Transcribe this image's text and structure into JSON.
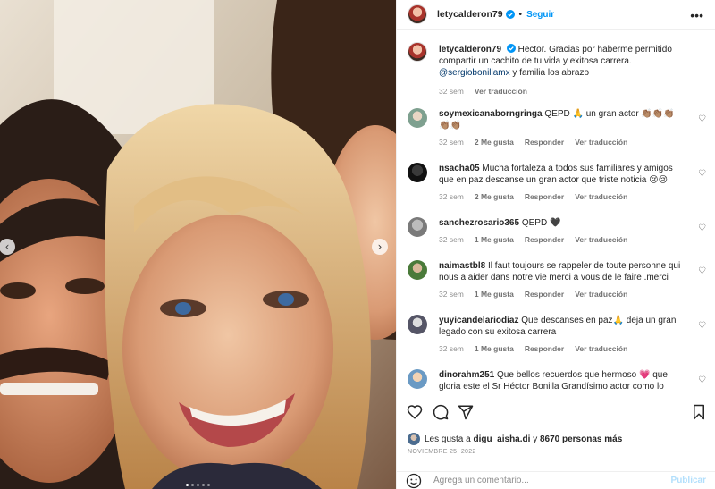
{
  "colors": {
    "accent": "#0095f6",
    "muted": "#8e8e8e",
    "mention": "#00376b",
    "post_disabled": "#b2dffc"
  },
  "photo": {
    "slides": 5,
    "active_slide": 1
  },
  "header": {
    "username": "letycalderon79",
    "separator": "•",
    "follow_label": "Seguir",
    "more_icon": "more-horizontal-icon"
  },
  "caption": {
    "username": "letycalderon79",
    "text_before_mention": "Hector. Gracias por haberme permitido compartir un cachito de tu vida y exitosa carrera.",
    "mention": "@sergiobonillamx",
    "text_after_mention": " y familia los abrazo",
    "time": "32 sem",
    "translate": "Ver traducción"
  },
  "comments": [
    {
      "username": "soymexicanaborngringa",
      "text": "QEPD 🙏 un gran actor 👏🏽👏🏽👏🏽👏🏽👏🏽",
      "time": "32 sem",
      "likes": "2 Me gusta",
      "reply": "Responder",
      "translate": "Ver traducción"
    },
    {
      "username": "nsacha05",
      "text": "Mucha fortaleza a todos sus familiares y amigos que en paz descanse un gran actor que triste noticia 😢😢",
      "time": "32 sem",
      "likes": "2 Me gusta",
      "reply": "Responder",
      "translate": "Ver traducción"
    },
    {
      "username": "sanchezrosario365",
      "text": "QEPD 🖤",
      "time": "32 sem",
      "likes": "1 Me gusta",
      "reply": "Responder",
      "translate": "Ver traducción"
    },
    {
      "username": "naimastbl8",
      "text": "Il faut toujours se rappeler de toute personne qui nous a aider dans notre vie merci a vous de le faire .merci",
      "time": "32 sem",
      "likes": "1 Me gusta",
      "reply": "Responder",
      "translate": "Ver traducción"
    },
    {
      "username": "yuyicandelariodiaz",
      "text": "Que descanses en paz🙏 deja un gran legado con su exitosa carrera",
      "time": "32 sem",
      "likes": "1 Me gusta",
      "reply": "Responder",
      "translate": "Ver traducción"
    },
    {
      "username": "dinorahm251",
      "text": "Que bellos recuerdos que hermoso 💗 que gloria este el Sr Héctor Bonilla Grandísimo actor como lo",
      "time": "",
      "likes": "",
      "reply": "",
      "translate": ""
    }
  ],
  "likes": {
    "prefix": "Les gusta a",
    "user": "digu_aisha.di",
    "connector": "y",
    "count": "8670 personas más"
  },
  "date": "NOVIEMBRE 25, 2022",
  "add_comment": {
    "placeholder": "Agrega un comentario...",
    "post_label": "Publicar"
  }
}
